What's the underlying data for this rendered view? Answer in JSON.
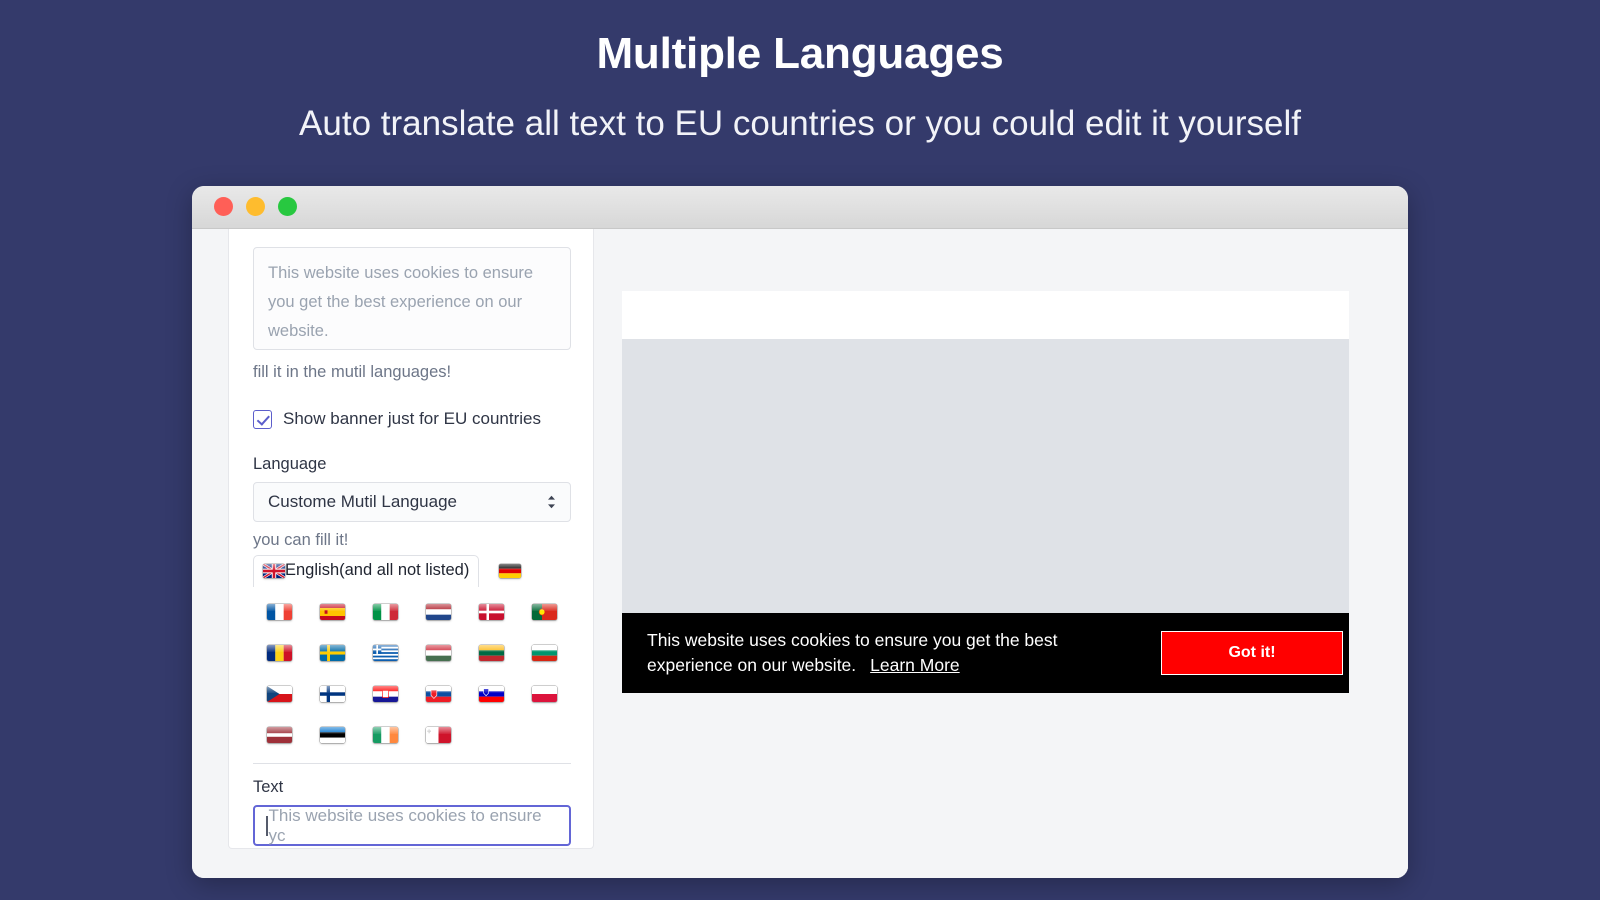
{
  "hero": {
    "title": "Multiple Languages",
    "subtitle": "Auto translate all text to EU countries or you could edit it yourself"
  },
  "window": {
    "traffic_lights": {
      "close_color": "#ff5f57",
      "minimize_color": "#febc2e",
      "maximize_color": "#28c840"
    }
  },
  "sidebar": {
    "textarea_value": "This website uses cookies to ensure you get the best experience on our website.",
    "helper_text": "fill it in the mutil languages!",
    "checkbox": {
      "label": "Show banner just for EU countries",
      "checked": "true",
      "accent_color": "#5c5ecb"
    },
    "language_section": {
      "label": "Language",
      "selected": "Custome Mutil Language",
      "options": [
        "Custome Mutil Language"
      ],
      "hint": "you can fill it!"
    },
    "language_tabs": [
      {
        "label": "English(and all not listed)",
        "flag": "flag-gb",
        "active": "true"
      },
      {
        "label": "",
        "flag": "flag-de",
        "active": "false"
      }
    ],
    "flag_grid": [
      {
        "name": "France",
        "flag": "flag-fr"
      },
      {
        "name": "Spain",
        "flag": "flag-es"
      },
      {
        "name": "Italy",
        "flag": "flag-it"
      },
      {
        "name": "Netherlands",
        "flag": "flag-nl"
      },
      {
        "name": "Denmark",
        "flag": "flag-dk"
      },
      {
        "name": "Portugal",
        "flag": "flag-pt"
      },
      {
        "name": "Romania",
        "flag": "flag-ro"
      },
      {
        "name": "Sweden",
        "flag": "flag-se"
      },
      {
        "name": "Greece",
        "flag": "flag-gr"
      },
      {
        "name": "Hungary",
        "flag": "flag-hu"
      },
      {
        "name": "Lithuania",
        "flag": "flag-lt"
      },
      {
        "name": "Bulgaria",
        "flag": "flag-bg"
      },
      {
        "name": "Czech Republic",
        "flag": "flag-cz"
      },
      {
        "name": "Finland",
        "flag": "flag-fi"
      },
      {
        "name": "Croatia",
        "flag": "flag-hr"
      },
      {
        "name": "Slovakia",
        "flag": "flag-sk"
      },
      {
        "name": "Slovenia",
        "flag": "flag-si"
      },
      {
        "name": "Poland",
        "flag": "flag-pl"
      },
      {
        "name": "Latvia",
        "flag": "flag-lv"
      },
      {
        "name": "Estonia",
        "flag": "flag-ee"
      },
      {
        "name": "Ireland",
        "flag": "flag-ie"
      },
      {
        "name": "Malta",
        "flag": "flag-mt"
      }
    ],
    "text_field": {
      "label": "Text",
      "placeholder": "This website uses cookies to ensure yc",
      "value": "",
      "focus_color": "#6366d6"
    }
  },
  "preview": {
    "cookie_banner": {
      "message": "This website uses cookies to ensure you get the best experience on our website.",
      "link_label": "Learn More",
      "button_label": "Got it!",
      "background": "#000000",
      "button_color": "#ff0000"
    }
  }
}
